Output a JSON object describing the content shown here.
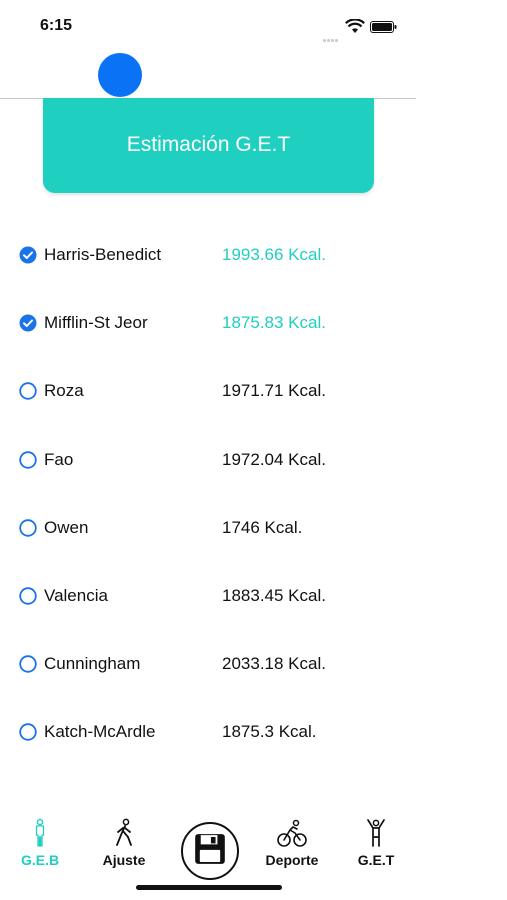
{
  "status_bar": {
    "time": "6:15"
  },
  "card": {
    "title": "Estimación G.E.T"
  },
  "colors": {
    "accent": "#1fcfc0",
    "avatar": "#0a73f5",
    "checkbox": "#1a73e8"
  },
  "formulas": [
    {
      "name": "Harris-Benedict",
      "value": "1993.66 Kcal.",
      "checked": true
    },
    {
      "name": "Mifflin-St Jeor",
      "value": "1875.83 Kcal.",
      "checked": true
    },
    {
      "name": "Roza",
      "value": "1971.71 Kcal.",
      "checked": false
    },
    {
      "name": "Fao",
      "value": "1972.04 Kcal.",
      "checked": false
    },
    {
      "name": "Owen",
      "value": "1746 Kcal.",
      "checked": false
    },
    {
      "name": "Valencia",
      "value": "1883.45 Kcal.",
      "checked": false
    },
    {
      "name": "Cunningham",
      "value": "2033.18 Kcal.",
      "checked": false
    },
    {
      "name": "Katch-McArdle",
      "value": "1875.3 Kcal.",
      "checked": false
    }
  ],
  "tabs": {
    "geb": {
      "label": "G.E.B",
      "icon": "standing-person-icon",
      "active": true
    },
    "ajuste": {
      "label": "Ajuste",
      "icon": "walking-person-icon",
      "active": false
    },
    "save": {
      "icon": "floppy-disk-icon"
    },
    "deporte": {
      "label": "Deporte",
      "icon": "cyclist-icon",
      "active": false
    },
    "get": {
      "label": "G.E.T",
      "icon": "arms-up-person-icon",
      "active": false
    }
  }
}
